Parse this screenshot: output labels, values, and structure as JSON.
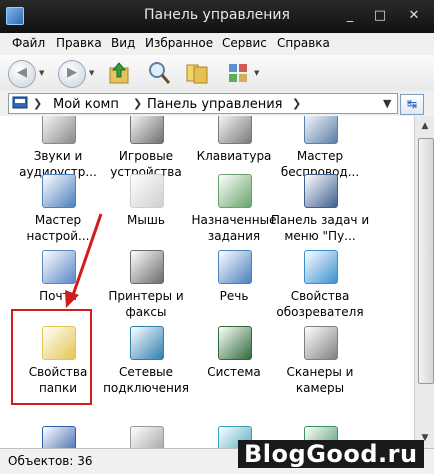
{
  "window": {
    "title": "Панель управления"
  },
  "window_controls": {
    "minimize": "_",
    "maximize": "□",
    "close": "✕"
  },
  "menu": [
    "Файл",
    "Правка",
    "Вид",
    "Избранное",
    "Сервис",
    "Справка"
  ],
  "toolbar": {
    "back_icon": "back-arrow-icon",
    "forward_icon": "forward-arrow-icon",
    "up_icon": "up-folder-icon",
    "search_icon": "search-icon",
    "folders_icon": "folders-icon",
    "views_icon": "views-icon"
  },
  "address": {
    "segments": [
      "Мой комп",
      "Панель управления"
    ],
    "go_icon": "go-refresh-icon"
  },
  "items": [
    {
      "label": "Звуки и аудиоустр...",
      "icon": "sounds-icon",
      "color": "#8a8a8a"
    },
    {
      "label": "Игровые устройства",
      "icon": "gamepad-icon",
      "color": "#6f6f6f"
    },
    {
      "label": "Клавиатура",
      "icon": "keyboard-icon",
      "color": "#7a7a7a"
    },
    {
      "label": "Мастер беспровод...",
      "icon": "wireless-icon",
      "color": "#5b7fa8"
    },
    {
      "label": "Мастер настрой...",
      "icon": "setup-wizard-icon",
      "color": "#4c7fbf"
    },
    {
      "label": "Мышь",
      "icon": "mouse-icon",
      "color": "#cfcfcf"
    },
    {
      "label": "Назначенные задания",
      "icon": "scheduled-tasks-icon",
      "color": "#6aa36a"
    },
    {
      "label": "Панель задач и меню \"Пу...",
      "icon": "taskbar-icon",
      "color": "#3f5f8f"
    },
    {
      "label": "Почта",
      "icon": "mail-icon",
      "color": "#5a86c7"
    },
    {
      "label": "Принтеры и факсы",
      "icon": "printer-icon",
      "color": "#6b6b6b"
    },
    {
      "label": "Речь",
      "icon": "speech-icon",
      "color": "#4a7fc0"
    },
    {
      "label": "Свойства обозревателя",
      "icon": "internet-options-icon",
      "color": "#3a8fd0"
    },
    {
      "label": "Свойства папки",
      "icon": "folder-options-icon",
      "color": "#e5c552"
    },
    {
      "label": "Сетевые подключения",
      "icon": "network-icon",
      "color": "#2e7fb0"
    },
    {
      "label": "Система",
      "icon": "system-icon",
      "color": "#2d6b3a"
    },
    {
      "label": "Сканеры и камеры",
      "icon": "scanner-icon",
      "color": "#7f7f7f"
    },
    {
      "label": "",
      "icon": "security-center-icon",
      "color": "#2f5fa8"
    },
    {
      "label": "",
      "icon": "phone-modem-icon",
      "color": "#9a9a9a"
    },
    {
      "label": "",
      "icon": "add-remove-icon",
      "color": "#3aa0b8"
    },
    {
      "label": "",
      "icon": "hardware-icon",
      "color": "#3f8f5f"
    }
  ],
  "status": {
    "text": "Объектов: 36"
  },
  "watermark": {
    "text": "BlogGood.ru"
  },
  "colors": {
    "highlight": "#d11c1c",
    "titlebar": "#111111"
  }
}
